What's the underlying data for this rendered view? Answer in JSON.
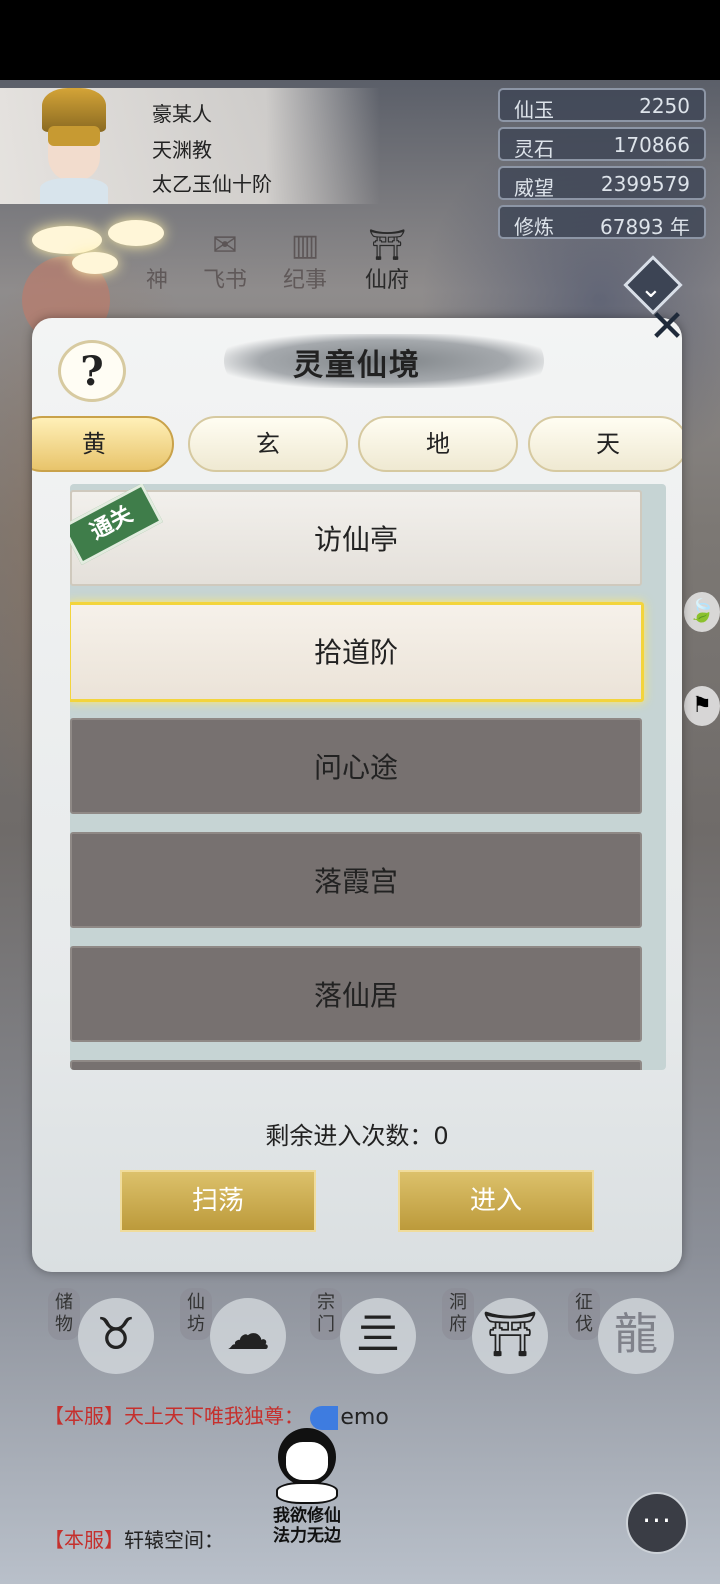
{
  "player": {
    "name": "豪某人",
    "sect": "天渊教",
    "rank": "太乙玉仙十阶"
  },
  "stats": [
    {
      "label": "仙玉",
      "value": "2250"
    },
    {
      "label": "灵石",
      "value": "170866"
    },
    {
      "label": "威望",
      "value": "2399579"
    },
    {
      "label": "修炼",
      "value": "67893 年"
    }
  ],
  "top_nav": [
    {
      "label": "神",
      "icon": "deity-icon"
    },
    {
      "label": "飞书",
      "icon": "letter-icon"
    },
    {
      "label": "纪事",
      "icon": "scroll-icon"
    },
    {
      "label": "仙府",
      "icon": "mansion-icon"
    }
  ],
  "modal": {
    "title": "灵童仙境",
    "help_label": "?",
    "close_label": "✕",
    "tabs": [
      {
        "label": "黄",
        "active": true
      },
      {
        "label": "玄",
        "active": false
      },
      {
        "label": "地",
        "active": false
      },
      {
        "label": "天",
        "active": false
      }
    ],
    "stages": [
      {
        "name": "访仙亭",
        "state": "cleared",
        "badge": "通关"
      },
      {
        "name": "拾道阶",
        "state": "selected"
      },
      {
        "name": "问心途",
        "state": "locked"
      },
      {
        "name": "落霞宫",
        "state": "locked"
      },
      {
        "name": "落仙居",
        "state": "locked"
      }
    ],
    "remaining_label": "剩余进入次数：",
    "remaining_value": "0",
    "sweep_button": "扫荡",
    "enter_button": "进入"
  },
  "bottom_nav": [
    {
      "label": "储物",
      "glyph": "♉",
      "icon": "bag-icon"
    },
    {
      "label": "仙坊",
      "glyph": "☁",
      "icon": "shop-icon"
    },
    {
      "label": "宗门",
      "glyph": "亖",
      "icon": "sect-gate-icon"
    },
    {
      "label": "洞府",
      "glyph": "⛩",
      "icon": "cave-pavilion-icon"
    },
    {
      "label": "征伐",
      "glyph": "龍",
      "icon": "dragon-icon"
    }
  ],
  "chat": [
    {
      "tag": "【本服】",
      "speaker": "天上天下唯我独尊：",
      "message": "emo"
    },
    {
      "tag": "【本服】",
      "speaker": "轩辕空间："
    }
  ],
  "meme_caption": "我欲修仙 法力无边",
  "chat_button": "···"
}
